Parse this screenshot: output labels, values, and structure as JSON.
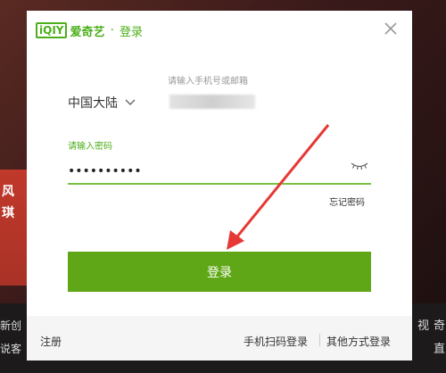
{
  "background": {
    "left_chars": [
      "风",
      "琪"
    ],
    "left_edge": [
      "新创",
      "说客"
    ],
    "right_edge": [
      "视",
      "奇",
      "直"
    ]
  },
  "dialog": {
    "logo_mark": "iQIY",
    "logo_text": "爱奇艺",
    "dot": "·",
    "title": "登录",
    "close_icon": "close-icon"
  },
  "form": {
    "phone_placeholder": "请输入手机号或邮箱",
    "region": "中国大陆",
    "password_label": "请输入密码",
    "password_value": "••••••••••",
    "forgot_password": "忘记密码",
    "login_button": "登录"
  },
  "footer": {
    "register": "注册",
    "qr_login": "手机扫码登录",
    "other_login": "其他方式登录"
  },
  "colors": {
    "accent": "#4caf1a",
    "button": "#5fa716",
    "arrow": "#e53935"
  }
}
